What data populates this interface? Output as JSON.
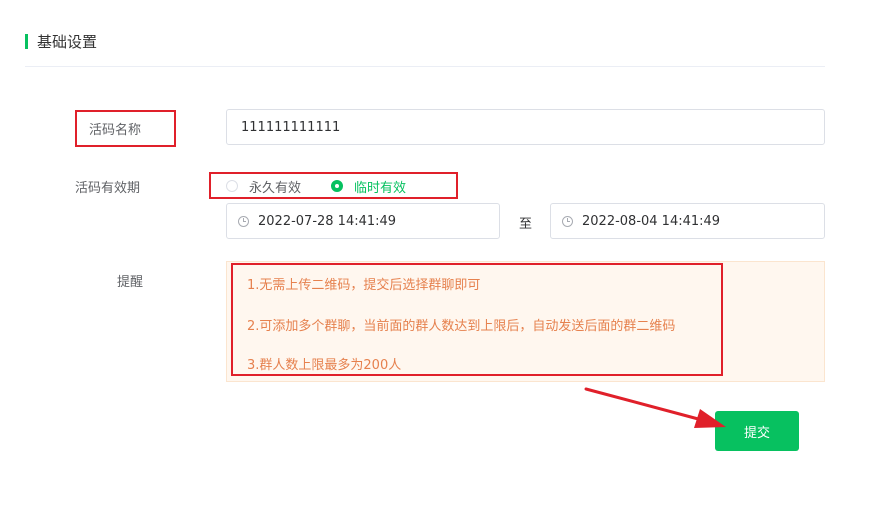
{
  "section": {
    "title": "基础设置"
  },
  "form": {
    "name": {
      "label": "活码名称",
      "value": "111111111111"
    },
    "validity": {
      "label": "活码有效期",
      "options": [
        {
          "label": "永久有效",
          "checked": false
        },
        {
          "label": "临时有效",
          "checked": true
        }
      ],
      "start": "2022-07-28 14:41:49",
      "separator": "至",
      "end": "2022-08-04 14:41:49"
    },
    "reminder": {
      "label": "提醒",
      "lines": [
        "1.无需上传二维码，提交后选择群聊即可",
        "2.可添加多个群聊，当前面的群人数达到上限后，自动发送后面的群二维码",
        "3.群人数上限最多为200人"
      ]
    }
  },
  "submit_label": "提交",
  "colors": {
    "accent": "#07c160",
    "highlight": "#e0202a",
    "notice_text": "#e6814e",
    "notice_bg": "#fff7ef"
  }
}
